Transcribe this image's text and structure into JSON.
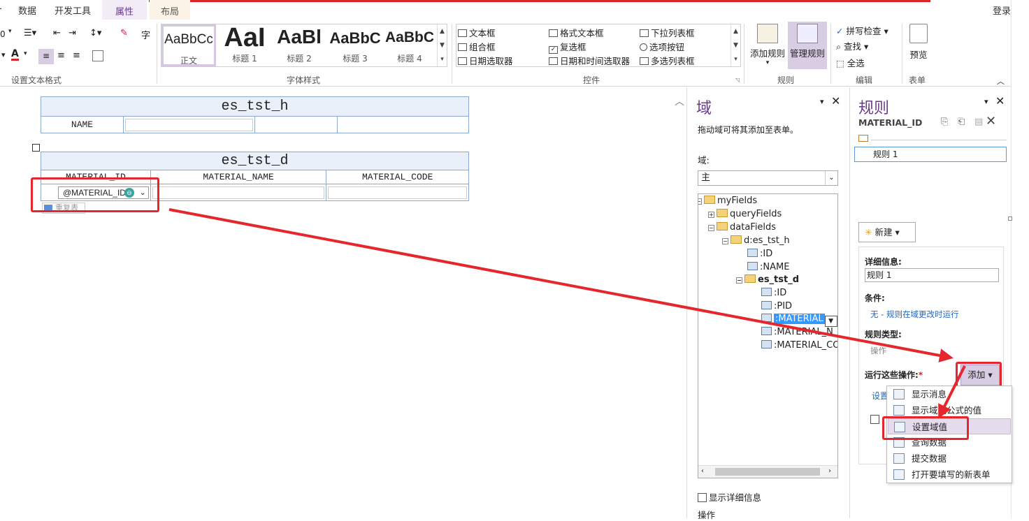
{
  "tabs": [
    "数据",
    "开发工具",
    "属性",
    "布局"
  ],
  "signin": "登录",
  "ribbon": {
    "font_size_fragment": "0",
    "char_label": "字",
    "groups": {
      "text_format": "设置文本格式",
      "styles": "字体样式",
      "controls": "控件",
      "rules": "规则",
      "edit": "编辑",
      "form": "表单"
    },
    "styles": [
      {
        "sample": "AaBbCc",
        "caption": "正文"
      },
      {
        "sample": "AaI",
        "caption": "标题 1"
      },
      {
        "sample": "AaBl",
        "caption": "标题 2"
      },
      {
        "sample": "AaBbC",
        "caption": "标题 3"
      },
      {
        "sample": "AaBbC",
        "caption": "标题 4"
      }
    ],
    "controls": [
      {
        "label": "文本框",
        "icon": "textbox-icon"
      },
      {
        "label": "组合框",
        "icon": "combobox-icon"
      },
      {
        "label": "日期选取器",
        "icon": "datepicker-icon"
      },
      {
        "label": "格式文本框",
        "icon": "richtext-icon"
      },
      {
        "label": "复选框",
        "icon": "checkbox-icon"
      },
      {
        "label": "日期和时间选取器",
        "icon": "datetime-icon"
      },
      {
        "label": "下拉列表框",
        "icon": "dropdown-icon"
      },
      {
        "label": "选项按钮",
        "icon": "radio-icon"
      },
      {
        "label": "多选列表框",
        "icon": "multiselect-icon"
      }
    ],
    "add_rule": "添加规则",
    "manage_rules": "管理规则",
    "spellcheck": "拼写检查",
    "find": "查找",
    "select_all": "全选",
    "preview": "预览"
  },
  "doc": {
    "header_table_title": "es_tst_h",
    "name_label": "NAME",
    "detail_table_title": "es_tst_d",
    "columns": [
      "MATERIAL_ID",
      "MATERIAL_NAME",
      "MATERIAL_CODE"
    ],
    "material_id_field": "@MATERIAL_ID",
    "repeating_label": "重复表"
  },
  "fields_panel": {
    "title": "域",
    "hint": "拖动域可将其添加至表单。",
    "fields_label": "域:",
    "source": "主",
    "tree": [
      "myFields",
      "queryFields",
      "dataFields",
      "d:es_tst_h",
      ":ID",
      ":NAME",
      "es_tst_d",
      ":ID",
      ":PID",
      ":MATERIAL",
      ":MATERIAL_N",
      ":MATERIAL_CO"
    ],
    "show_details": "显示详细信息",
    "actions": "操作"
  },
  "rules_panel": {
    "title": "规则",
    "field": "MATERIAL_ID",
    "rule_item": "规则 1",
    "new_button": "新建",
    "details_label": "详细信息:",
    "rule_name": "规则 1",
    "condition_label": "条件:",
    "condition_value": "无 - 规则在域更改时运行",
    "rule_type_label": "规则类型:",
    "rule_type_value": "操作",
    "run_actions_label": "运行这些操作:",
    "required_mark": "*",
    "add_button": "添加",
    "set_link": "设置"
  },
  "add_menu": [
    "显示消息",
    "显示域或公式的值",
    "设置域值",
    "查询数据",
    "提交数据",
    "打开要填写的新表单"
  ],
  "colors": {
    "accent": "#6b3a8b",
    "highlight_red": "#e5272d",
    "selected_blue": "#3399ff"
  }
}
